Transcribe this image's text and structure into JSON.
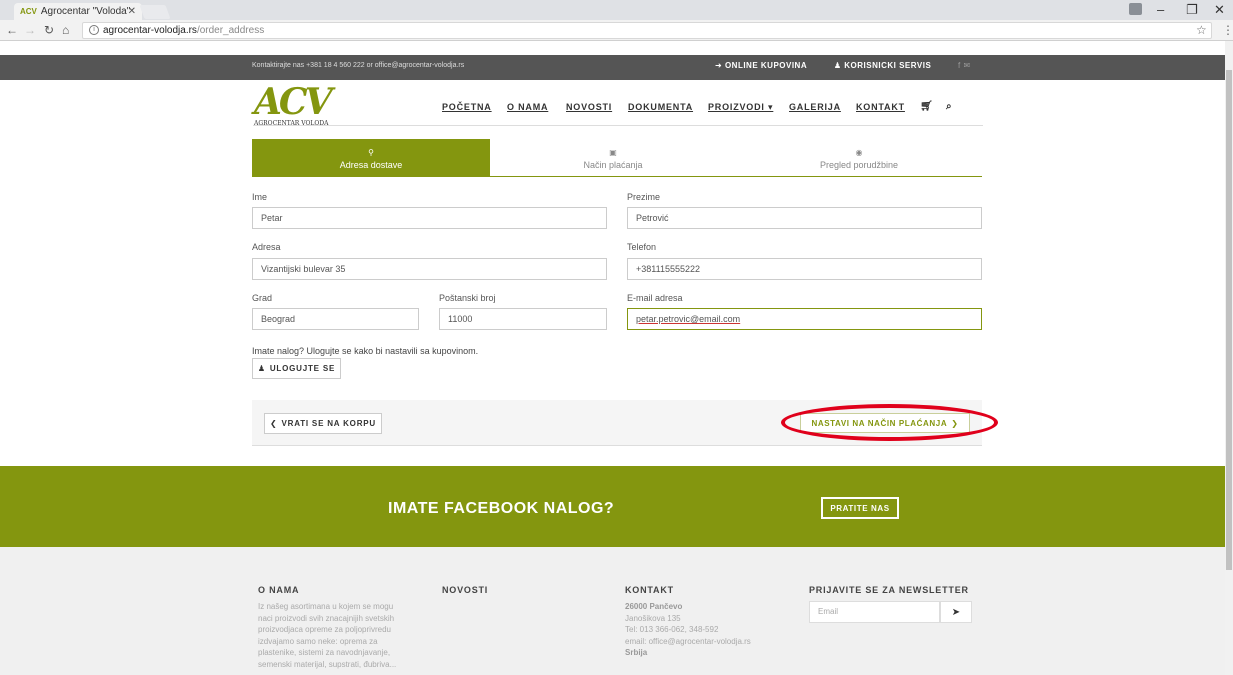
{
  "browser": {
    "tab_title": "Agrocentar \"Voloda\"",
    "tab_favicon": "ACV",
    "url_host": "agrocentar-volodja.rs",
    "url_path": "/order_address",
    "icons": [
      "back-icon",
      "forward-icon",
      "reload-icon",
      "home-icon",
      "info-icon",
      "star-icon",
      "menu-icon"
    ]
  },
  "topbar": {
    "contact": "Kontaktirajte nas +381 18 4 560 222 or office@agrocentar-volodja.rs",
    "online": "ONLINE KUPOVINA",
    "service": "KORISNICKI SERVIS",
    "social": "f ✉"
  },
  "logo": {
    "mark": "ACV",
    "name": "AGROCENTAR VOLODA"
  },
  "nav": {
    "items": [
      "POČETNA",
      "O NAMA",
      "NOVOSTI",
      "DOKUMENTA",
      "PROIZVODI ▾",
      "GALERIJA",
      "KONTAKT"
    ],
    "cart_icon": "cart-icon",
    "search_icon": "search-icon"
  },
  "steps": [
    {
      "label": "Adresa dostave",
      "icon": "location-icon",
      "active": true
    },
    {
      "label": "Način plaćanja",
      "icon": "money-icon",
      "active": false
    },
    {
      "label": "Pregled porudžbine",
      "icon": "eye-icon",
      "active": false
    }
  ],
  "form": {
    "ime": {
      "label": "Ime",
      "value": "Petar"
    },
    "prezime": {
      "label": "Prezime",
      "value": "Petrović"
    },
    "adresa": {
      "label": "Adresa",
      "value": "Vizantijski bulevar 35"
    },
    "telefon": {
      "label": "Telefon",
      "value": "+381115555222"
    },
    "grad": {
      "label": "Grad",
      "value": "Beograd"
    },
    "postanski": {
      "label": "Poštanski broj",
      "value": "11000"
    },
    "email": {
      "label": "E-mail adresa",
      "value": "petar.petrovic@email.com"
    },
    "login_text": "Imate nalog? Ulogujte se kako bi nastavili sa kupovinom.",
    "login_button": "ULOGUJTE SE",
    "back_button": "VRATI SE NA KORPU",
    "continue_button": "NASTAVI NA NAČIN PLAĆANJA"
  },
  "banner": {
    "title": "IMATE FACEBOOK NALOG?",
    "button": "PRATITE NAS"
  },
  "footer": {
    "about_title": "O NAMA",
    "about_lines": [
      "Iz našeg asortimana u kojem se mogu",
      "naci proizvodi svih znacajnijih svetskih",
      "proizvodjaca opreme za poljoprivredu",
      "izdvajamo samo neke: oprema za",
      "plastenike, sistemi za navodnjavanje,",
      "semenski materijal, supstrati, đubriva..."
    ],
    "news_title": "NOVOSTI",
    "contact_title": "KONTAKT",
    "contact_city": "26000 Pančevo",
    "contact_lines": [
      "Janošikova 135",
      "Tel: 013 366-062, 348-592",
      "email: office@agrocentar-volodja.rs"
    ],
    "contact_country": "Srbija",
    "newsletter_title": "PRIJAVITE SE ZA NEWSLETTER",
    "newsletter_placeholder": "Email"
  }
}
